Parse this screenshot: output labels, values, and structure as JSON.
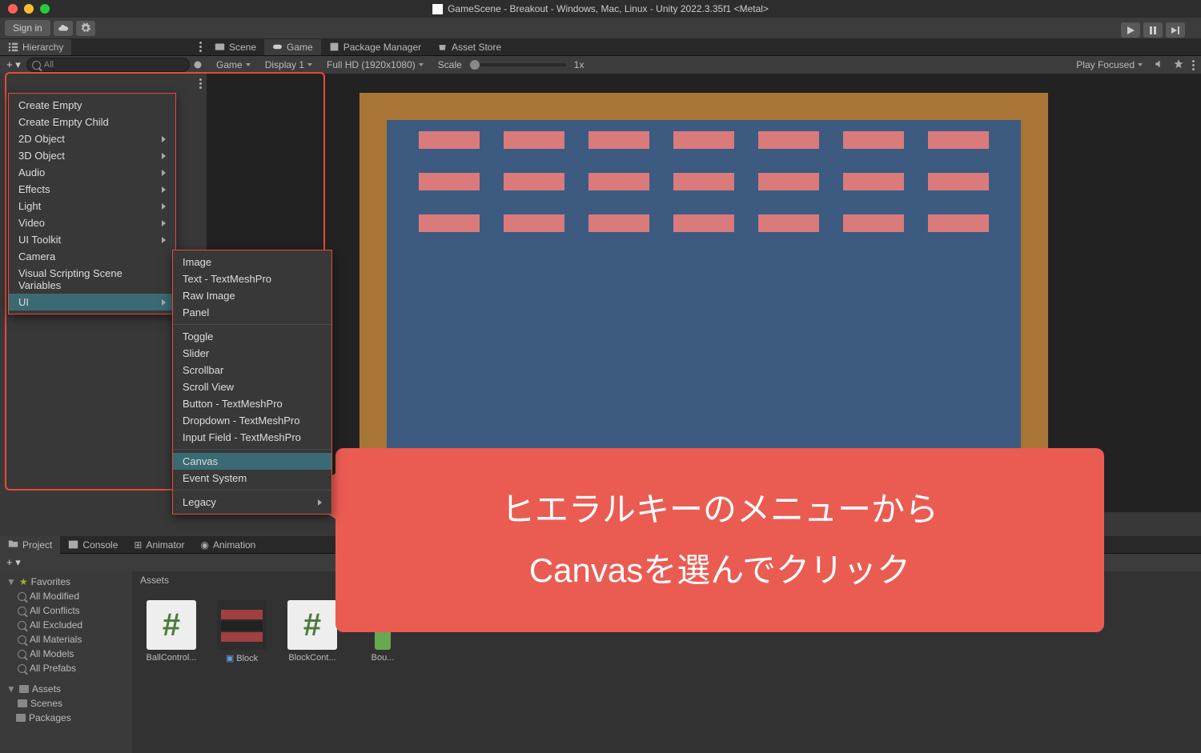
{
  "window": {
    "title": "GameScene - Breakout - Windows, Mac, Linux - Unity 2022.3.35f1 <Metal>"
  },
  "toolbar": {
    "signin": "Sign in"
  },
  "tabs": {
    "hierarchy": "Hierarchy",
    "scene": "Scene",
    "game": "Game",
    "package_manager": "Package Manager",
    "asset_store": "Asset Store"
  },
  "hierarchy": {
    "search_placeholder": "All"
  },
  "game_toolbar": {
    "mode": "Game",
    "display": "Display 1",
    "resolution": "Full HD (1920x1080)",
    "scale_label": "Scale",
    "scale_value": "1x",
    "play_focused": "Play Focused"
  },
  "context_menu1": {
    "items": [
      {
        "label": "Create Empty",
        "submenu": false
      },
      {
        "label": "Create Empty Child",
        "submenu": false
      },
      {
        "label": "2D Object",
        "submenu": true
      },
      {
        "label": "3D Object",
        "submenu": true
      },
      {
        "label": "Audio",
        "submenu": true
      },
      {
        "label": "Effects",
        "submenu": true
      },
      {
        "label": "Light",
        "submenu": true
      },
      {
        "label": "Video",
        "submenu": true
      },
      {
        "label": "UI Toolkit",
        "submenu": true
      },
      {
        "label": "Camera",
        "submenu": false
      },
      {
        "label": "Visual Scripting Scene Variables",
        "submenu": false
      },
      {
        "label": "UI",
        "submenu": true,
        "highlighted": true
      }
    ]
  },
  "context_menu2": {
    "group1": [
      "Image",
      "Text - TextMeshPro",
      "Raw Image",
      "Panel"
    ],
    "group2": [
      "Toggle",
      "Slider",
      "Scrollbar",
      "Scroll View",
      "Button - TextMeshPro",
      "Dropdown - TextMeshPro",
      "Input Field - TextMeshPro"
    ],
    "group3": [
      {
        "label": "Canvas",
        "highlighted": true
      },
      {
        "label": "Event System",
        "highlighted": false
      }
    ],
    "group4": [
      {
        "label": "Legacy",
        "submenu": true
      }
    ]
  },
  "callout": {
    "line1": "ヒエラルキーのメニューから",
    "line2": "Canvasを選んでクリック"
  },
  "project": {
    "tabs": {
      "project": "Project",
      "console": "Console",
      "animator": "Animator",
      "animation": "Animation"
    },
    "favorites_label": "Favorites",
    "favorites": [
      "All Modified",
      "All Conflicts",
      "All Excluded",
      "All Materials",
      "All Models",
      "All Prefabs"
    ],
    "assets_label": "Assets",
    "assets_children": [
      "Scenes"
    ],
    "packages_label": "Packages",
    "breadcrumb": "Assets",
    "assets": [
      {
        "name": "BallControl...",
        "type": "script"
      },
      {
        "name": "Block",
        "type": "prefab"
      },
      {
        "name": "BlockCont...",
        "type": "script"
      },
      {
        "name": "Bou...",
        "type": "script_partial"
      }
    ]
  }
}
